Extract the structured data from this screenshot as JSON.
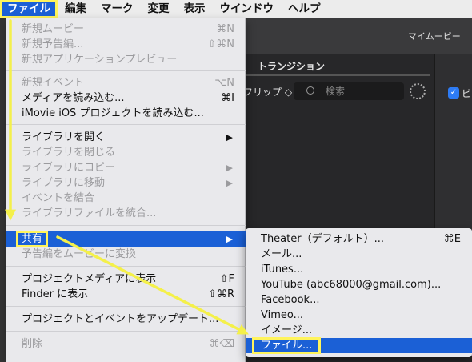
{
  "menubar": {
    "items": [
      {
        "label": "ファイル"
      },
      {
        "label": "編集"
      },
      {
        "label": "マーク"
      },
      {
        "label": "変更"
      },
      {
        "label": "表示"
      },
      {
        "label": "ウインドウ"
      },
      {
        "label": "ヘルプ"
      }
    ]
  },
  "background": {
    "window_title": "マイムービー",
    "transition_tab": "トランジション",
    "clip_label": "フリップ ◇",
    "search_placeholder": "検索",
    "checkbox_label": "ビ"
  },
  "file_menu": {
    "new_movie": {
      "label": "新規ムービー",
      "shortcut": "⌘N"
    },
    "new_trailer": {
      "label": "新規予告編...",
      "shortcut": "⇧⌘N"
    },
    "new_app_preview": {
      "label": "新規アプリケーションプレビュー"
    },
    "new_event": {
      "label": "新規イベント",
      "shortcut": "⌥N"
    },
    "import_media": {
      "label": "メディアを読み込む...",
      "shortcut": "⌘I"
    },
    "import_ios": {
      "label": "iMovie iOS プロジェクトを読み込む..."
    },
    "open_library": {
      "label": "ライブラリを開く",
      "arrow": "▶"
    },
    "close_library": {
      "label": "ライブラリを閉じる"
    },
    "copy_to_library": {
      "label": "ライブラリにコピー",
      "arrow": "▶"
    },
    "move_to_library": {
      "label": "ライブラリに移動",
      "arrow": "▶"
    },
    "merge_events": {
      "label": "イベントを結合"
    },
    "consolidate_library": {
      "label": "ライブラリファイルを統合..."
    },
    "share": {
      "label": "共有",
      "arrow": "▶"
    },
    "convert_trailer": {
      "label": "予告編をムービーに変換"
    },
    "reveal_project_media": {
      "label": "プロジェクトメディアに表示",
      "shortcut": "⇧F"
    },
    "reveal_finder": {
      "label": "Finder に表示",
      "shortcut": "⇧⌘R"
    },
    "update_projects": {
      "label": "プロジェクトとイベントをアップデート..."
    },
    "delete": {
      "label": "削除",
      "shortcut": "⌘⌫"
    }
  },
  "share_submenu": {
    "theater": {
      "label": "Theater（デフォルト）...",
      "shortcut": "⌘E"
    },
    "email": {
      "label": "メール..."
    },
    "itunes": {
      "label": "iTunes..."
    },
    "youtube": {
      "label": "YouTube (abc68000@gmail.com)..."
    },
    "facebook": {
      "label": "Facebook..."
    },
    "vimeo": {
      "label": "Vimeo..."
    },
    "image": {
      "label": "イメージ..."
    },
    "file": {
      "label": "ファイル..."
    }
  },
  "colors": {
    "accent": "#1b60d6",
    "highlight": "#fff45c",
    "arrow": "#f4f04a"
  }
}
